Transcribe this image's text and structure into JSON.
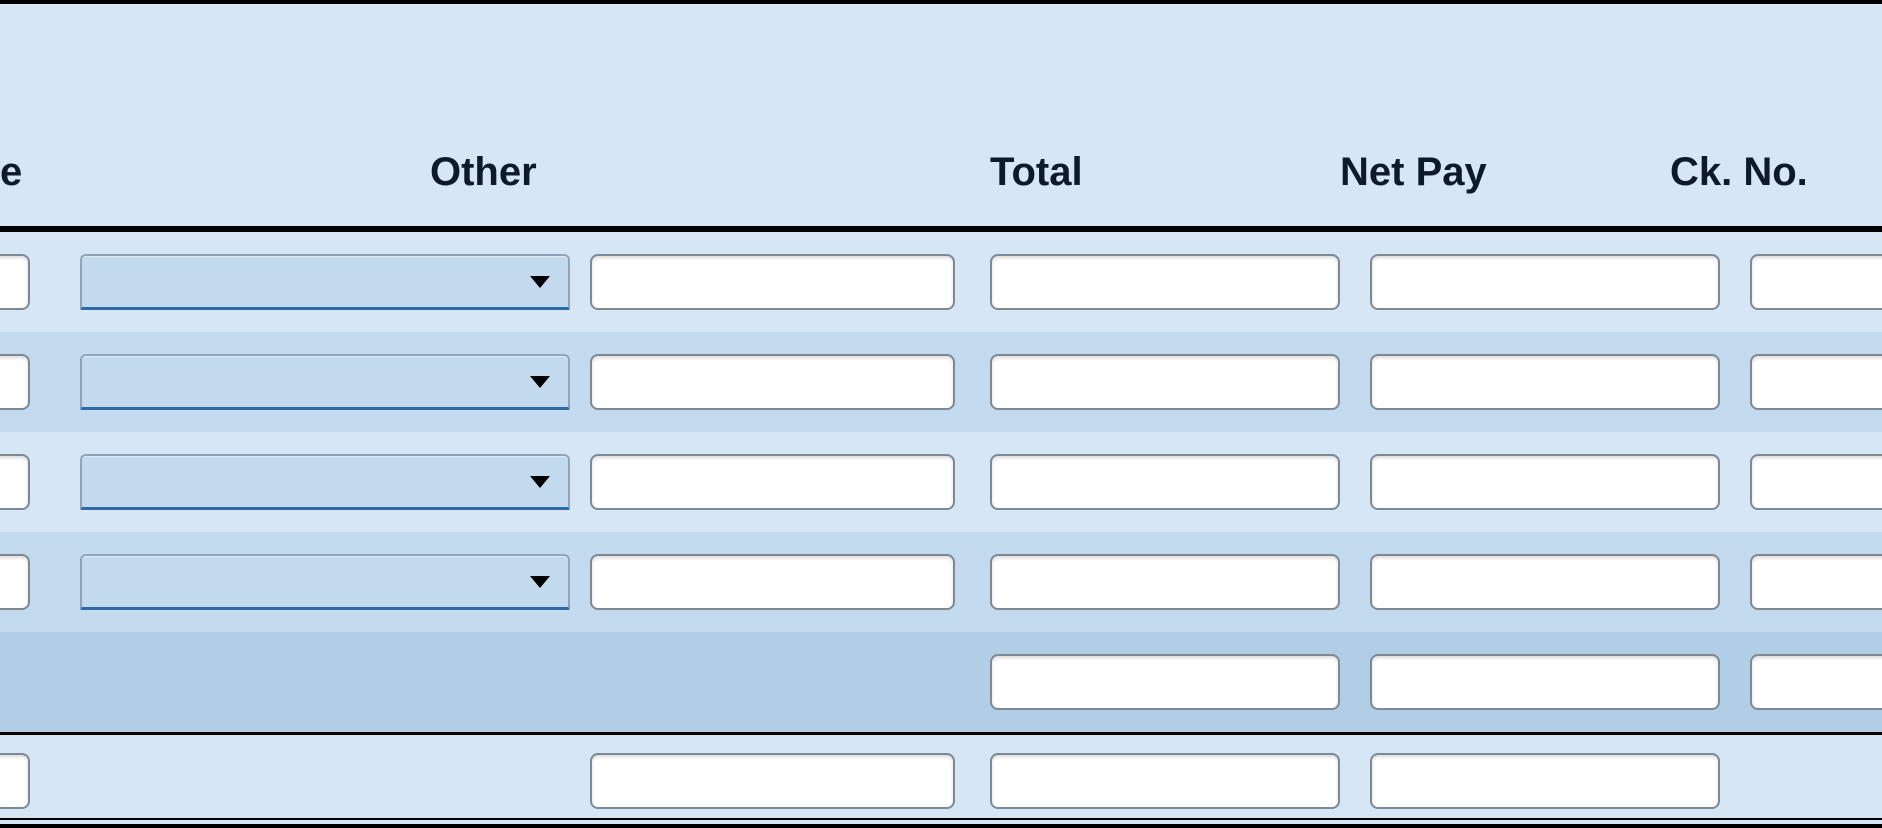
{
  "headers": {
    "col0_partial": "e",
    "other": "Other",
    "total": "Total",
    "net_pay": "Net Pay",
    "ck_no": "Ck. No."
  },
  "rows": [
    {
      "left_frag": "",
      "other_select": "",
      "other_amount": "",
      "total": "",
      "net_pay": "",
      "ck_no": ""
    },
    {
      "left_frag": "",
      "other_select": "",
      "other_amount": "",
      "total": "",
      "net_pay": "",
      "ck_no": ""
    },
    {
      "left_frag": "",
      "other_select": "",
      "other_amount": "",
      "total": "",
      "net_pay": "",
      "ck_no": ""
    },
    {
      "left_frag": "",
      "other_select": "",
      "other_amount": "",
      "total": "",
      "net_pay": "",
      "ck_no": ""
    }
  ],
  "subtotal_row": {
    "total": "",
    "net_pay": "",
    "ck_no": ""
  },
  "footer_row": {
    "left_frag": "",
    "other_amount": "",
    "total": "",
    "net_pay": ""
  }
}
